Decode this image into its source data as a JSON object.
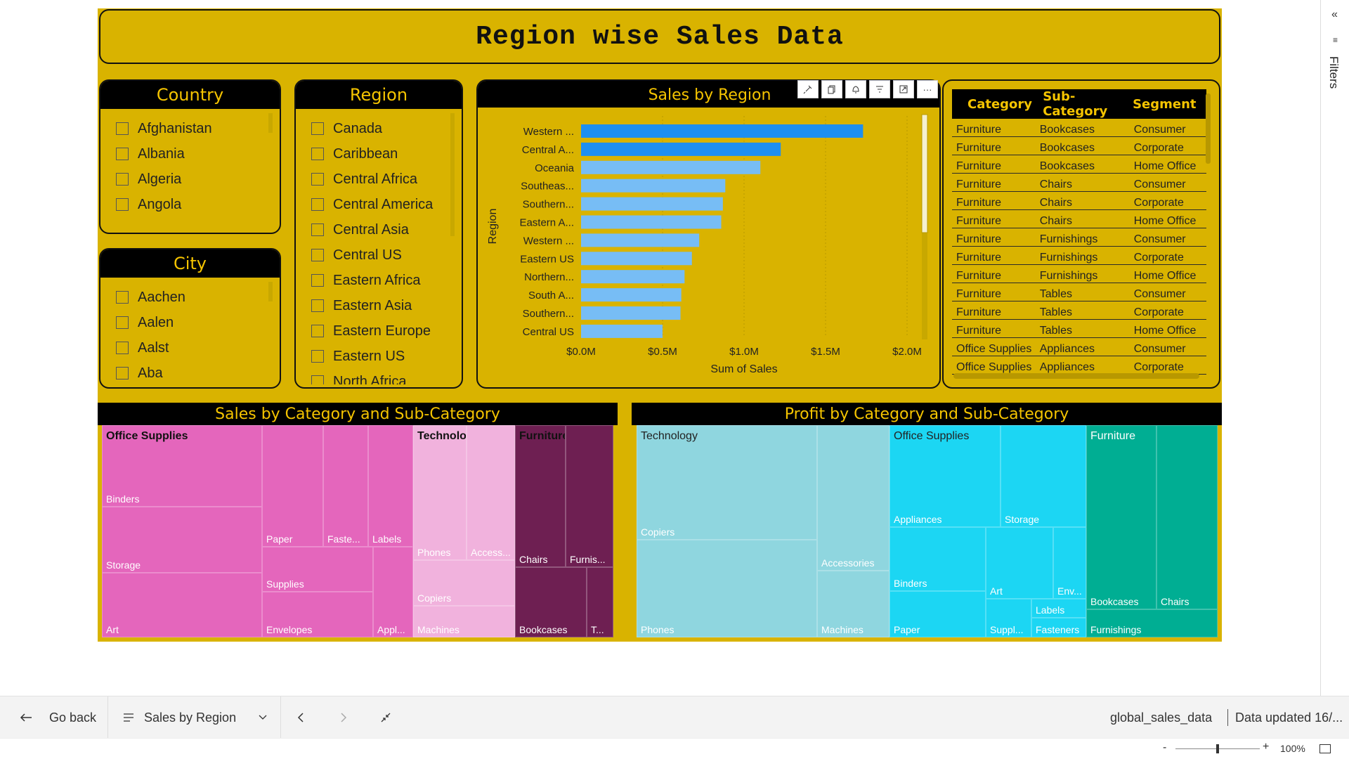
{
  "report": {
    "title": "Region wise Sales Data"
  },
  "country_slicer": {
    "header": "Country",
    "items": [
      "Afghanistan",
      "Albania",
      "Algeria",
      "Angola"
    ]
  },
  "city_slicer": {
    "header": "City",
    "items": [
      "Aachen",
      "Aalen",
      "Aalst",
      "Aba"
    ]
  },
  "region_slicer": {
    "header": "Region",
    "items": [
      "Canada",
      "Caribbean",
      "Central Africa",
      "Central America",
      "Central Asia",
      "Central US",
      "Eastern Africa",
      "Eastern Asia",
      "Eastern Europe",
      "Eastern US",
      "North Africa"
    ]
  },
  "visual_toolbar": {
    "icons": [
      "pin-icon",
      "copy-icon",
      "bell-icon",
      "filter-icon",
      "focus-icon",
      "more-icon"
    ],
    "more_label": "···"
  },
  "chart_data": {
    "type": "bar",
    "orientation": "horizontal",
    "title": "Sales by Region",
    "xlabel": "Sum of Sales",
    "ylabel": "Region",
    "categories": [
      "Western ...",
      "Central A...",
      "Oceania",
      "Southeas...",
      "Southern...",
      "Eastern A...",
      "Western ...",
      "Eastern US",
      "Northern...",
      "South A...",
      "Southern...",
      "Central US"
    ],
    "values": [
      1730000,
      1225000,
      1100000,
      885000,
      870000,
      860000,
      725000,
      680000,
      635000,
      615000,
      610000,
      500000
    ],
    "highlighted": [
      true,
      true,
      false,
      false,
      false,
      false,
      false,
      false,
      false,
      false,
      false,
      false
    ],
    "xlim": [
      0,
      2000000
    ],
    "xticks": [
      "$0.0M",
      "$0.5M",
      "$1.0M",
      "$1.5M",
      "$2.0M"
    ],
    "colors": {
      "highlight": "#1e8ff0",
      "normal": "#77bdf5"
    },
    "grid": true
  },
  "table": {
    "headers": [
      "Category",
      "Sub-Category",
      "Segment"
    ],
    "rows": [
      [
        "Furniture",
        "Bookcases",
        "Consumer"
      ],
      [
        "Furniture",
        "Bookcases",
        "Corporate"
      ],
      [
        "Furniture",
        "Bookcases",
        "Home Office"
      ],
      [
        "Furniture",
        "Chairs",
        "Consumer"
      ],
      [
        "Furniture",
        "Chairs",
        "Corporate"
      ],
      [
        "Furniture",
        "Chairs",
        "Home Office"
      ],
      [
        "Furniture",
        "Furnishings",
        "Consumer"
      ],
      [
        "Furniture",
        "Furnishings",
        "Corporate"
      ],
      [
        "Furniture",
        "Furnishings",
        "Home Office"
      ],
      [
        "Furniture",
        "Tables",
        "Consumer"
      ],
      [
        "Furniture",
        "Tables",
        "Corporate"
      ],
      [
        "Furniture",
        "Tables",
        "Home Office"
      ],
      [
        "Office Supplies",
        "Appliances",
        "Consumer"
      ],
      [
        "Office Supplies",
        "Appliances",
        "Corporate"
      ]
    ]
  },
  "sales_treemap": {
    "title": "Sales by Category and Sub-Category",
    "groups": [
      "Office Supplies",
      "Technology",
      "Furniture"
    ],
    "labels": {
      "binders": "Binders",
      "storage": "Storage",
      "art": "Art",
      "paper": "Paper",
      "fasteners": "Faste...",
      "labels": "Labels",
      "supplies": "Supplies",
      "envelopes": "Envelopes",
      "appliances": "Appl...",
      "phones": "Phones",
      "accessories": "Access...",
      "copiers": "Copiers",
      "machines": "Machines",
      "chairs": "Chairs",
      "furnishings": "Furnis...",
      "bookcases": "Bookcases",
      "tables": "T..."
    },
    "colors": {
      "office_supplies": "#e466bc",
      "technology": "#f1b2dd",
      "furniture": "#6e1f52"
    }
  },
  "profit_treemap": {
    "title": "Profit by Category and Sub-Category",
    "groups": [
      "Technology",
      "Office Supplies",
      "Furniture"
    ],
    "labels": {
      "copiers": "Copiers",
      "phones": "Phones",
      "accessories": "Accessories",
      "machines": "Machines",
      "appliances": "Appliances",
      "storage": "Storage",
      "binders": "Binders",
      "paper": "Paper",
      "art": "Art",
      "envelopes": "Env...",
      "labels": "Labels",
      "supplies": "Suppl...",
      "fasteners": "Fasteners",
      "bookcases": "Bookcases",
      "chairs": "Chairs",
      "furnishings": "Furnishings"
    },
    "colors": {
      "technology": "#8fd6df",
      "office_supplies": "#1cd6f3",
      "furniture": "#00ae93"
    }
  },
  "filters_pane": {
    "label": "Filters",
    "collapse_icon": "«",
    "filter_icon_glyph": "≡"
  },
  "bottom_bar": {
    "go_back": "Go back",
    "page_name": "Sales by Region",
    "dataset": "global_sales_data",
    "updated": "Data updated 16/..."
  },
  "status_bar": {
    "zoom": "100%",
    "zoom_minus": "-",
    "zoom_plus": "+",
    "zoom_fraction": 0.5
  }
}
